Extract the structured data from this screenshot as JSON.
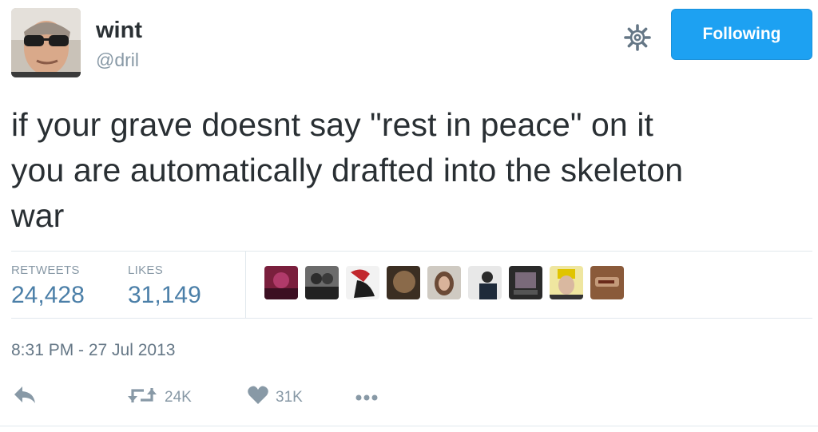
{
  "user": {
    "display_name": "wint",
    "handle": "@dril",
    "avatar_icon": "user-avatar-sunglasses"
  },
  "header": {
    "settings_icon": "gear-icon",
    "follow_button_label": "Following",
    "accent_color": "#1da1f2"
  },
  "tweet": {
    "lines": [
      "if your grave doesnt say \"rest in peace\" on it",
      "you are automatically drafted into the skeleton",
      "war"
    ]
  },
  "stats": {
    "retweets_label": "RETWEETS",
    "retweets_value": "24,428",
    "likes_label": "LIKES",
    "likes_value": "31,149",
    "liker_avatars": [
      "liker-1",
      "liker-2",
      "liker-3",
      "liker-4",
      "liker-5",
      "liker-6",
      "liker-7",
      "liker-8",
      "liker-9"
    ]
  },
  "meta": {
    "timestamp": "8:31 PM - 27 Jul 2013"
  },
  "actions": {
    "reply_icon": "reply-icon",
    "retweet_icon": "retweet-icon",
    "retweet_count": "24K",
    "like_icon": "heart-icon",
    "like_count": "31K",
    "more_icon": "more-dots-icon"
  }
}
